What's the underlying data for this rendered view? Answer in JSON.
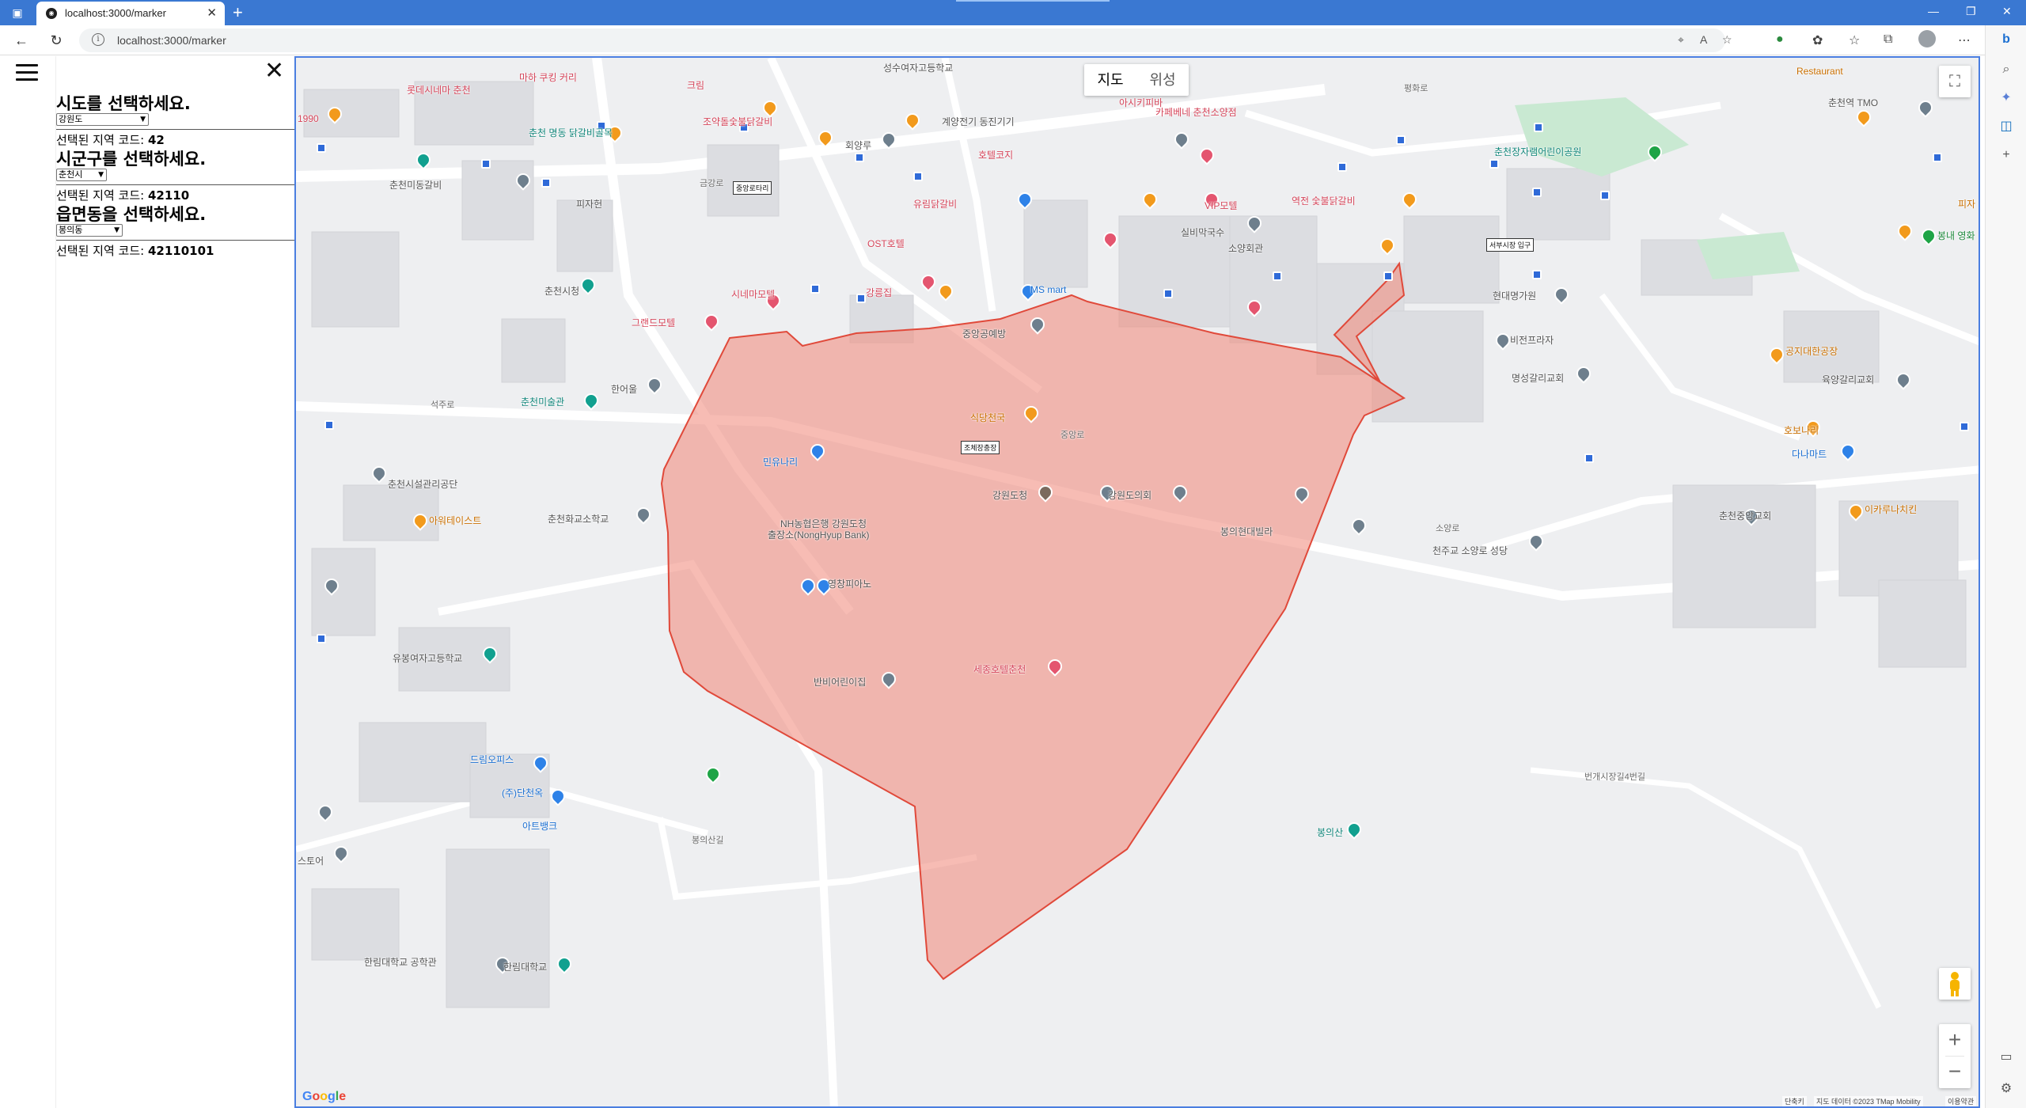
{
  "browser": {
    "tab_title": "localhost:3000/marker",
    "url": "localhost:3000/marker",
    "tab_close": "✕",
    "new_tab": "+"
  },
  "panel": {
    "close_glyph": "✕",
    "sido": {
      "heading": "시도를 선택하세요.",
      "selected": "강원도",
      "code_label": "선택된 지역 코드:",
      "code": "42"
    },
    "sigungu": {
      "heading": "시군구를 선택하세요.",
      "selected": "춘천시",
      "code_label": "선택된 지역 코드:",
      "code": "42110"
    },
    "eupmyeondong": {
      "heading": "읍면동을 선택하세요.",
      "selected": "봉의동",
      "code_label": "선택된 지역 코드:",
      "code": "42110101"
    }
  },
  "map": {
    "type_buttons": [
      "지도",
      "위성"
    ],
    "polygon_fill": "#f28b7e",
    "polygon_stroke": "#e0493a",
    "google": "Google",
    "attribution_shortcuts": "단축키",
    "attribution_data": "지도 데이터 ©2023 TMap Mobility",
    "attribution_terms": "이용약관",
    "labels": {
      "l_lotte": "롯데시네마 춘천",
      "l_mahoi": "마하 쿠킹 커리",
      "l_kuelbit": "크림",
      "l_sungsu": "성수여자고등학교",
      "l_1990": "1990",
      "l_myeongdong": "춘천 명동 닭갈비골목",
      "l_jojak": "조약돌숯불닭갈비",
      "l_gyeyang": "계양전기 동진기기",
      "l_hotelkoji": "호텔코지",
      "l_ashiki": "아시키피바",
      "l_cafe": "카페베네 춘천소양점",
      "l_restaurant": "Restaurant",
      "l_chuncheon_tmo": "춘천역 TMO",
      "l_jangcheon": "춘천장자램어린이공원",
      "l_pyeonghwaro": "평화로",
      "l_chuncheonmidong": "춘천미동갈비",
      "l_hoeyang": "회양루",
      "l_pijjaheoni": "피자헌",
      "l_jungangtonali": "중앙로타리",
      "l_yakboo": "유림닭갈비",
      "l_vip": "VIP모텔",
      "l_yunyeom": "역전 숯불닭갈비",
      "l_ost": "OST호텔",
      "l_silbi": "실비막국수",
      "l_soyang": "소양회관",
      "l_chuncheonsicheong": "춘천시청",
      "l_simaemotel": "시네마모텔",
      "l_msmart": "MS mart",
      "l_gangwonhill": "강릉집",
      "l_seobu": "서부시장 입구",
      "l_hyeondae": "현대명가원",
      "l_granhotel": "그랜드모텔",
      "l_jungangdong": "중앙공예방",
      "l_bijeon": "비전프라자",
      "l_gongji": "공지대한공장",
      "l_myeongseong": "명성갈리교회",
      "l_yukyang": "육양갈리교회",
      "l_chuncheonart": "춘천미술관",
      "l_hanohe": "한어울",
      "l_sikdang": "식당천국",
      "l_jochae": "조체장충장",
      "l_hobonari": "호보나리",
      "l_danamart": "다나마트",
      "l_minyunari": "민유나리",
      "l_gangwondocheong": "강원도청",
      "l_gangwondoeuihoe": "강원도의회",
      "l_chuncheonsiseol": "춘천시설관리공단",
      "l_ajoatesu": "아워테이스트",
      "l_nh": "NH농협은행 강원도청",
      "l_nh2": "출장소(NongHyup Bank)",
      "l_bongui_hyundai": "봉의현대빌라",
      "l_chuncheonjungang": "춘천중앙교회",
      "l_icarus": "이카루나치킨",
      "l_chuncheonhwagyo": "춘천화교소학교",
      "l_yeongchang": "영창피아노",
      "l_jungang_sungdang": "천주교 소양로 성당",
      "l_bananaeorini": "반비어린이집",
      "l_sejong": "세종호텔춘천",
      "l_yubong": "유봉여자고등학교",
      "l_dream": "드림오피스",
      "l_danchun": "(주)단천옥",
      "l_artbank": "아트뱅크",
      "l_bonguisan": "봉의산",
      "l_hallim_gong": "한림대학교 공학관",
      "l_hallim": "한림대학교",
      "l_seoroe": "스토어",
      "l_bongnae": "봉내 영화",
      "l_pija": "피자",
      "l_road_geumgang": "금강로",
      "l_road_bongui": "봉의산길",
      "l_road_hyeonyo": "번개시장길4번길",
      "l_road_soyang": "소양로",
      "l_road_jungang": "중앙로",
      "l_road_seok": "석주로"
    }
  }
}
